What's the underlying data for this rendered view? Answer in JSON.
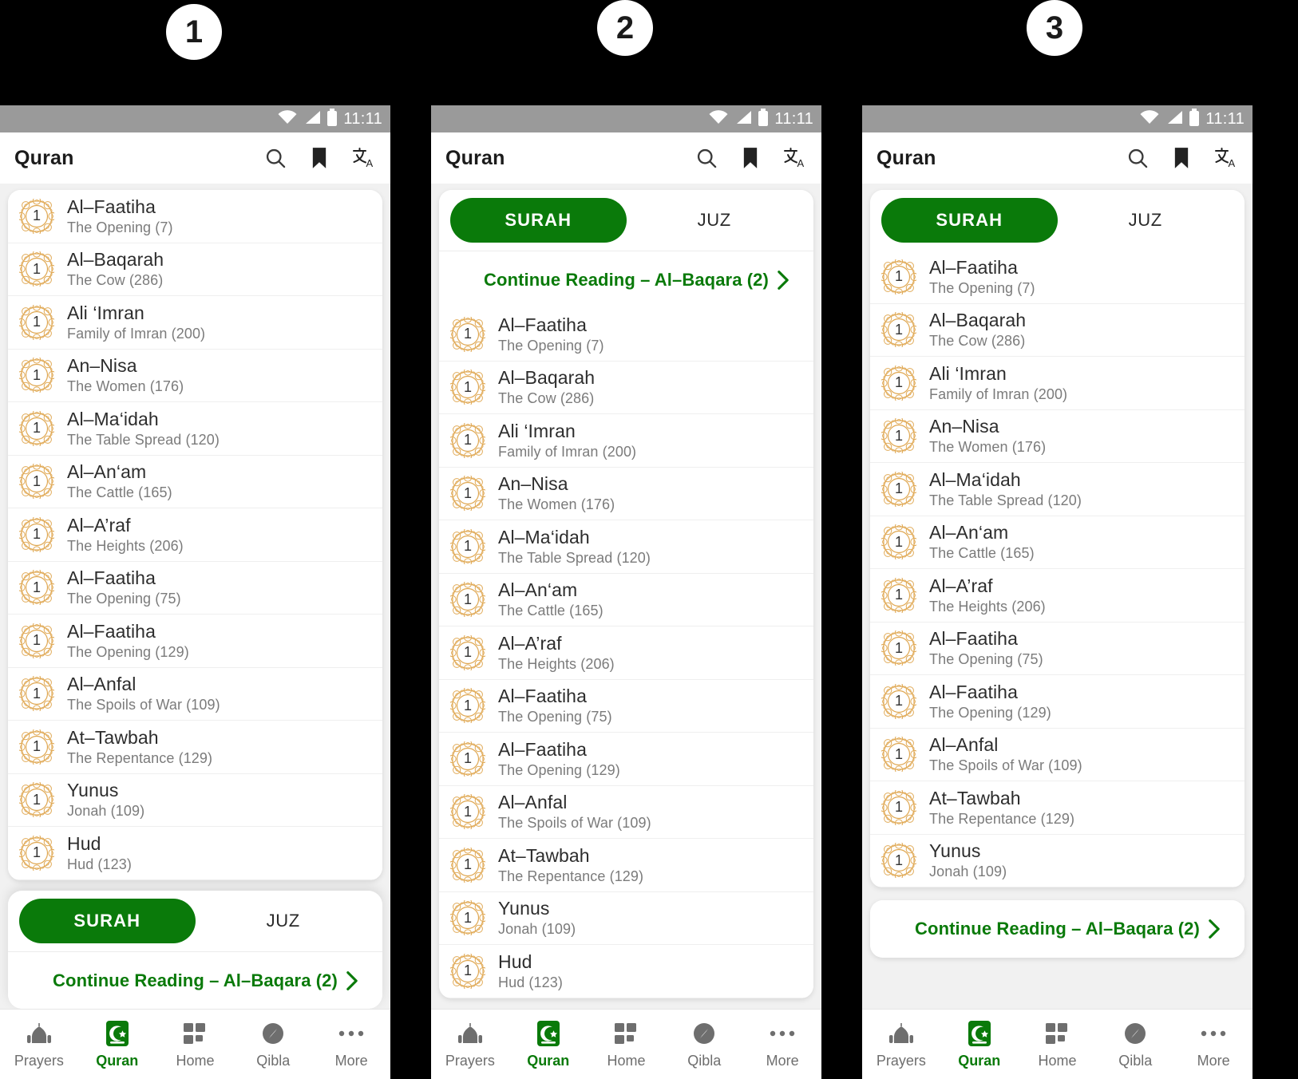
{
  "steps": [
    {
      "label": "1"
    },
    {
      "label": "2"
    },
    {
      "label": "3"
    }
  ],
  "colors": {
    "green": "#0a7a0a",
    "gold": "#e0a955",
    "statusbar": "#9a9a9a",
    "page_bg": "#f1f1f1",
    "text_primary": "#2d2d2d",
    "text_secondary": "#7b7b7b"
  },
  "statusbar": {
    "time": "11:11",
    "icons": [
      "wifi-icon",
      "signal-icon",
      "battery-icon"
    ]
  },
  "appbar": {
    "title": "Quran",
    "actions": [
      {
        "name": "search-icon",
        "label": "Search"
      },
      {
        "name": "bookmark-icon",
        "label": "Bookmarks"
      },
      {
        "name": "translate-icon",
        "label": "Translation"
      }
    ]
  },
  "tabs": {
    "surah": "SURAH",
    "juz": "JUZ",
    "active": "SURAH"
  },
  "continue_reading": {
    "label": "Continue Reading – Al–Baqara (2)",
    "chevron": "chevron-right-icon"
  },
  "surah_list": [
    {
      "number": "1",
      "name": "Al–Faatiha",
      "subtitle": "The Opening (7)"
    },
    {
      "number": "1",
      "name": "Al–Baqarah",
      "subtitle": "The Cow (286)"
    },
    {
      "number": "1",
      "name": "Ali ‘Imran",
      "subtitle": "Family of Imran (200)"
    },
    {
      "number": "1",
      "name": "An–Nisa",
      "subtitle": "The Women (176)"
    },
    {
      "number": "1",
      "name": "Al–Ma‘idah",
      "subtitle": "The Table Spread (120)"
    },
    {
      "number": "1",
      "name": "Al–An‘am",
      "subtitle": "The Cattle (165)"
    },
    {
      "number": "1",
      "name": "Al–A’raf",
      "subtitle": "The Heights (206)"
    },
    {
      "number": "1",
      "name": "Al–Faatiha",
      "subtitle": "The Opening (75)"
    },
    {
      "number": "1",
      "name": "Al–Faatiha",
      "subtitle": "The Opening (129)"
    },
    {
      "number": "1",
      "name": "Al–Anfal",
      "subtitle": "The Spoils of War (109)"
    },
    {
      "number": "1",
      "name": "At–Tawbah",
      "subtitle": "The Repentance (129)"
    },
    {
      "number": "1",
      "name": "Yunus",
      "subtitle": "Jonah (109)"
    },
    {
      "number": "1",
      "name": "Hud",
      "subtitle": "Hud (123)"
    }
  ],
  "bottom_nav": [
    {
      "label": "Prayers",
      "icon": "mosque-icon",
      "active": false
    },
    {
      "label": "Quran",
      "icon": "quran-book-icon",
      "active": true
    },
    {
      "label": "Home",
      "icon": "grid-icon",
      "active": false
    },
    {
      "label": "Qibla",
      "icon": "compass-icon",
      "active": false
    },
    {
      "label": "More",
      "icon": "ellipsis-icon",
      "active": false
    }
  ],
  "panels": [
    {
      "id": "1",
      "layout": "list-with-bottom-overlay",
      "visible_rows": 13,
      "overlay": [
        "tabs",
        "continue_reading"
      ]
    },
    {
      "id": "2",
      "layout": "tabs-top-continue-then-list",
      "visible_rows": 13
    },
    {
      "id": "3",
      "layout": "tabs-top-list-then-continue-card",
      "visible_rows": 12
    }
  ]
}
